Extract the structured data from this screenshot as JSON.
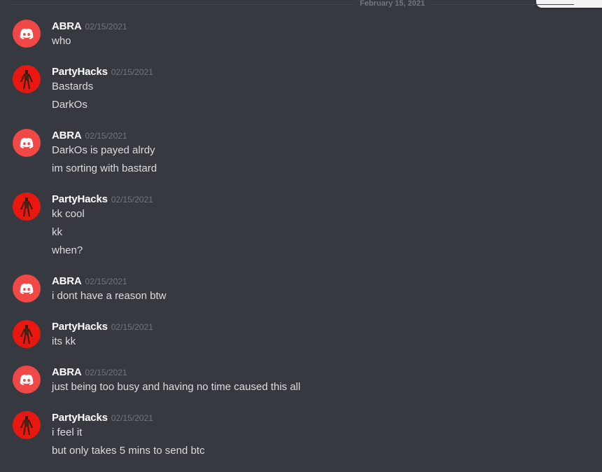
{
  "divider": {
    "date": "February 15, 2021"
  },
  "messages": [
    {
      "author": "ABRA",
      "avatar": "discord-logo-icon",
      "timestamp": "02/15/2021",
      "lines": [
        "who"
      ]
    },
    {
      "author": "PartyHacks",
      "avatar": "siren-head-avatar",
      "timestamp": "02/15/2021",
      "lines": [
        "Bastards",
        "DarkOs"
      ]
    },
    {
      "author": "ABRA",
      "avatar": "discord-logo-icon",
      "timestamp": "02/15/2021",
      "lines": [
        "DarkOs is payed alrdy",
        "im sorting with bastard"
      ]
    },
    {
      "author": "PartyHacks",
      "avatar": "siren-head-avatar",
      "timestamp": "02/15/2021",
      "lines": [
        "kk cool",
        "kk",
        "when?"
      ]
    },
    {
      "author": "ABRA",
      "avatar": "discord-logo-icon",
      "timestamp": "02/15/2021",
      "lines": [
        "i dont have a reason btw"
      ]
    },
    {
      "author": "PartyHacks",
      "avatar": "siren-head-avatar",
      "timestamp": "02/15/2021",
      "lines": [
        "its kk"
      ]
    },
    {
      "author": "ABRA",
      "avatar": "discord-logo-icon",
      "timestamp": "02/15/2021",
      "lines": [
        "just being too busy and having no time caused this all"
      ]
    },
    {
      "author": "PartyHacks",
      "avatar": "siren-head-avatar",
      "timestamp": "02/15/2021",
      "lines": [
        "i feel it",
        "but only takes 5 mins to send btc"
      ]
    }
  ],
  "colors": {
    "background": "#36393f",
    "username": "#ffffff",
    "message_text": "#dcddde",
    "timestamp": "#72767d",
    "discord_avatar": "#f04747",
    "party_avatar": "#e8170f"
  }
}
